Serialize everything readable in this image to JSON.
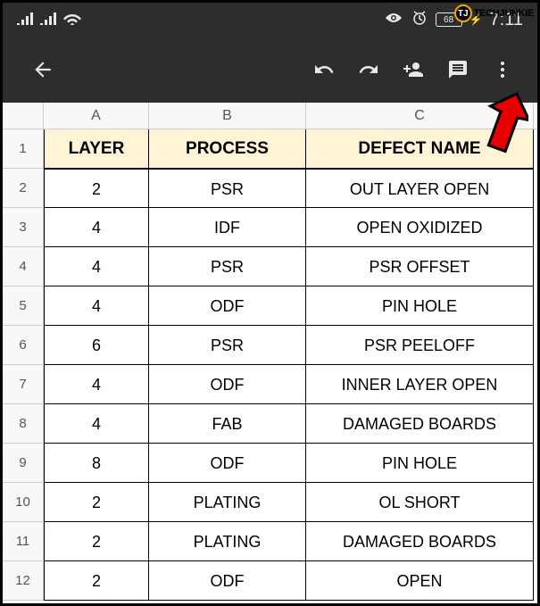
{
  "watermark": {
    "logo": "TJ",
    "text": "TECHJUNKIE"
  },
  "statusbar": {
    "battery": "68",
    "time": "7:11"
  },
  "columns": [
    "A",
    "B",
    "C"
  ],
  "headers": {
    "a": "LAYER",
    "b": "PROCESS",
    "c": "DEFECT NAME"
  },
  "rows": [
    {
      "n": "2",
      "a": "2",
      "b": "PSR",
      "c": "OUT LAYER OPEN"
    },
    {
      "n": "3",
      "a": "4",
      "b": "IDF",
      "c": "OPEN OXIDIZED"
    },
    {
      "n": "4",
      "a": "4",
      "b": "PSR",
      "c": "PSR OFFSET"
    },
    {
      "n": "5",
      "a": "4",
      "b": "ODF",
      "c": "PIN HOLE"
    },
    {
      "n": "6",
      "a": "6",
      "b": "PSR",
      "c": "PSR PEELOFF"
    },
    {
      "n": "7",
      "a": "4",
      "b": "ODF",
      "c": "INNER LAYER OPEN"
    },
    {
      "n": "8",
      "a": "4",
      "b": "FAB",
      "c": "DAMAGED BOARDS"
    },
    {
      "n": "9",
      "a": "8",
      "b": "ODF",
      "c": "PIN HOLE"
    },
    {
      "n": "10",
      "a": "2",
      "b": "PLATING",
      "c": "OL SHORT"
    },
    {
      "n": "11",
      "a": "2",
      "b": "PLATING",
      "c": "DAMAGED BOARDS"
    },
    {
      "n": "12",
      "a": "2",
      "b": "ODF",
      "c": "OPEN"
    }
  ]
}
